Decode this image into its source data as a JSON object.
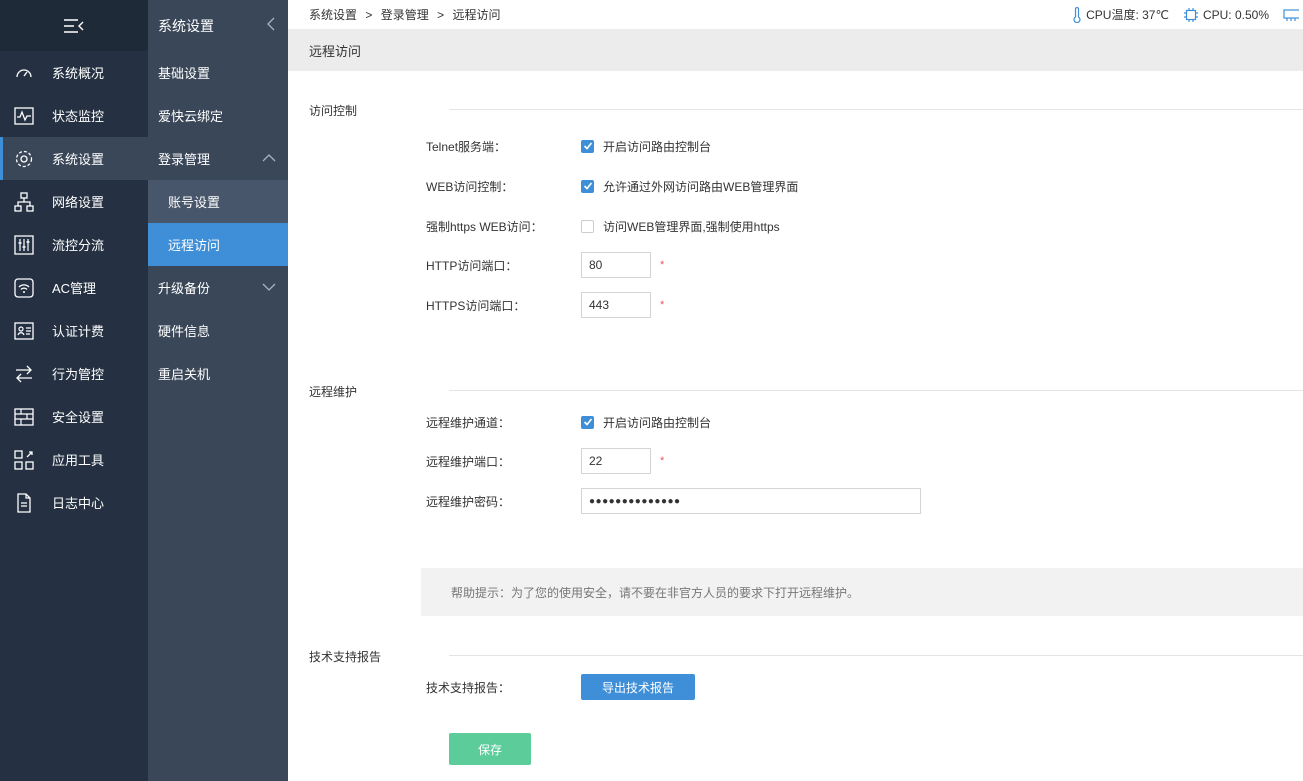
{
  "nav1": {
    "items": [
      {
        "label": "系统概况"
      },
      {
        "label": "状态监控"
      },
      {
        "label": "系统设置"
      },
      {
        "label": "网络设置"
      },
      {
        "label": "流控分流"
      },
      {
        "label": "AC管理"
      },
      {
        "label": "认证计费"
      },
      {
        "label": "行为管控"
      },
      {
        "label": "安全设置"
      },
      {
        "label": "应用工具"
      },
      {
        "label": "日志中心"
      }
    ]
  },
  "nav2": {
    "title": "系统设置",
    "items": [
      {
        "label": "基础设置"
      },
      {
        "label": "爱快云绑定"
      },
      {
        "label": "登录管理"
      },
      {
        "label": "账号设置"
      },
      {
        "label": "远程访问"
      },
      {
        "label": "升级备份"
      },
      {
        "label": "硬件信息"
      },
      {
        "label": "重启关机"
      }
    ]
  },
  "breadcrumb": [
    "系统设置",
    ">",
    "登录管理",
    ">",
    "远程访问"
  ],
  "status": {
    "cpu_temp": "CPU温度: 37℃",
    "cpu_usage": "CPU: 0.50%"
  },
  "page_title": "远程访问",
  "access_control": {
    "title": "访问控制",
    "telnet_label": "Telnet服务端：",
    "telnet_text": "开启访问路由控制台",
    "telnet_checked": true,
    "web_label": "WEB访问控制：",
    "web_text": "允许通过外网访问路由WEB管理界面",
    "web_checked": true,
    "https_label": "强制https WEB访问：",
    "https_text": "访问WEB管理界面,强制使用https",
    "https_checked": false,
    "http_port_label": "HTTP访问端口：",
    "http_port": "80",
    "https_port_label": "HTTPS访问端口：",
    "https_port": "443",
    "required": "*"
  },
  "remote": {
    "title": "远程维护",
    "channel_label": "远程维护通道：",
    "channel_text": "开启访问路由控制台",
    "channel_checked": true,
    "port_label": "远程维护端口：",
    "port": "22",
    "password_label": "远程维护密码：",
    "password": "●●●●●●●●●●●●●●",
    "required": "*"
  },
  "tip": "帮助提示：为了您的使用安全，请不要在非官方人员的要求下打开远程维护。",
  "tech": {
    "title": "技术支持报告",
    "label": "技术支持报告：",
    "export_button": "导出技术报告"
  },
  "save_button": "保存",
  "colors": {
    "accent": "#3f8fd8",
    "save": "#5ccc9a",
    "nav_dark": "#253142",
    "nav_mid": "#3a4759"
  }
}
